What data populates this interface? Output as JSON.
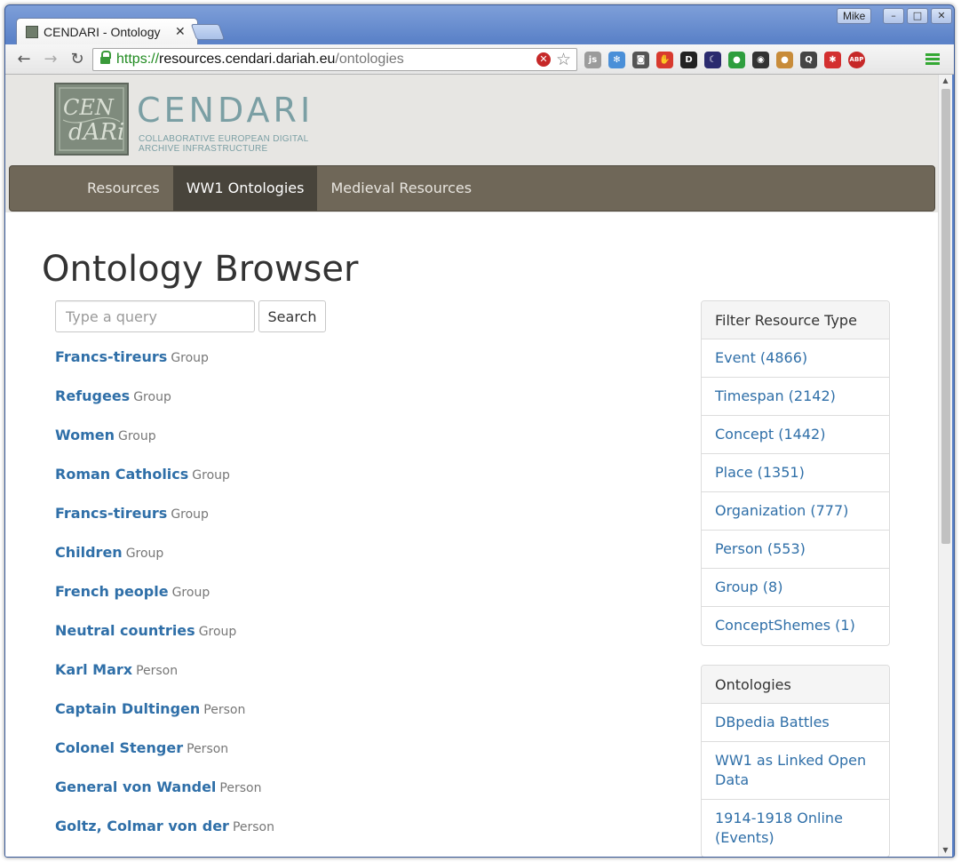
{
  "browser": {
    "tab_title": "CENDARI - Ontology",
    "user": "Mike",
    "url_scheme": "https://",
    "url_host": "resources.cendari.dariah.eu",
    "url_path": "/ontologies"
  },
  "extensions": [
    {
      "icon": "js-switch-icon",
      "label": "js",
      "color": "#9b9b9b"
    },
    {
      "icon": "snowflake-icon",
      "label": "✻",
      "color": "#4a8fd8"
    },
    {
      "icon": "pocket-icon",
      "label": "◙",
      "color": "#555555"
    },
    {
      "icon": "stop-hand-icon",
      "label": "✋",
      "color": "#d83a2e"
    },
    {
      "icon": "d-icon",
      "label": "D",
      "color": "#222222"
    },
    {
      "icon": "moon-icon",
      "label": "☾",
      "color": "#2a2a6e"
    },
    {
      "icon": "leaf-icon",
      "label": "●",
      "color": "#2e9e3e"
    },
    {
      "icon": "mask-icon",
      "label": "◉",
      "color": "#333333"
    },
    {
      "icon": "cookie-icon",
      "label": "●",
      "color": "#c88c3a"
    },
    {
      "icon": "magnifier-icon",
      "label": "Q",
      "color": "#444444"
    },
    {
      "icon": "puzzle-icon",
      "label": "✱",
      "color": "#d32f2f"
    },
    {
      "icon": "adblock-icon",
      "label": "ABP",
      "color": "#c62828"
    }
  ],
  "site": {
    "logo_word": "CENDARI",
    "logo_sub_1": "COLLABORATIVE EUROPEAN DIGITAL",
    "logo_sub_2": "ARCHIVE INFRASTRUCTURE"
  },
  "nav": {
    "items": [
      {
        "label": "Resources"
      },
      {
        "label": "WW1 Ontologies"
      },
      {
        "label": "Medieval Resources"
      }
    ],
    "active_index": 1
  },
  "page": {
    "title": "Ontology Browser"
  },
  "search": {
    "placeholder": "Type a query",
    "value": "",
    "button_label": "Search"
  },
  "results": [
    {
      "name": "Francs-tireurs",
      "type": "Group"
    },
    {
      "name": "Refugees",
      "type": "Group"
    },
    {
      "name": "Women",
      "type": "Group"
    },
    {
      "name": "Roman Catholics",
      "type": "Group"
    },
    {
      "name": "Francs-tireurs",
      "type": "Group"
    },
    {
      "name": "Children",
      "type": "Group"
    },
    {
      "name": "French people",
      "type": "Group"
    },
    {
      "name": "Neutral countries",
      "type": "Group"
    },
    {
      "name": "Karl Marx",
      "type": "Person"
    },
    {
      "name": "Captain Dultingen",
      "type": "Person"
    },
    {
      "name": "Colonel Stenger",
      "type": "Person"
    },
    {
      "name": "General von Wandel",
      "type": "Person"
    },
    {
      "name": "Goltz, Colmar von der",
      "type": "Person"
    }
  ],
  "filter_panel": {
    "heading": "Filter Resource Type",
    "items": [
      {
        "label": "Event (4866)"
      },
      {
        "label": "Timespan (2142)"
      },
      {
        "label": "Concept (1442)"
      },
      {
        "label": "Place (1351)"
      },
      {
        "label": "Organization (777)"
      },
      {
        "label": "Person (553)"
      },
      {
        "label": "Group (8)"
      },
      {
        "label": "ConceptShemes (1)"
      }
    ]
  },
  "ontologies_panel": {
    "heading": "Ontologies",
    "items": [
      {
        "label": "DBpedia Battles"
      },
      {
        "label": "WW1 as Linked Open Data"
      },
      {
        "label": "1914-1918 Online (Events)"
      }
    ]
  },
  "colors": {
    "link": "#2f6fa8",
    "navbar": "#6f6758",
    "navbar_active": "#48443b",
    "logo_text": "#7b9fa4",
    "header_bg": "#e7e6e3"
  }
}
